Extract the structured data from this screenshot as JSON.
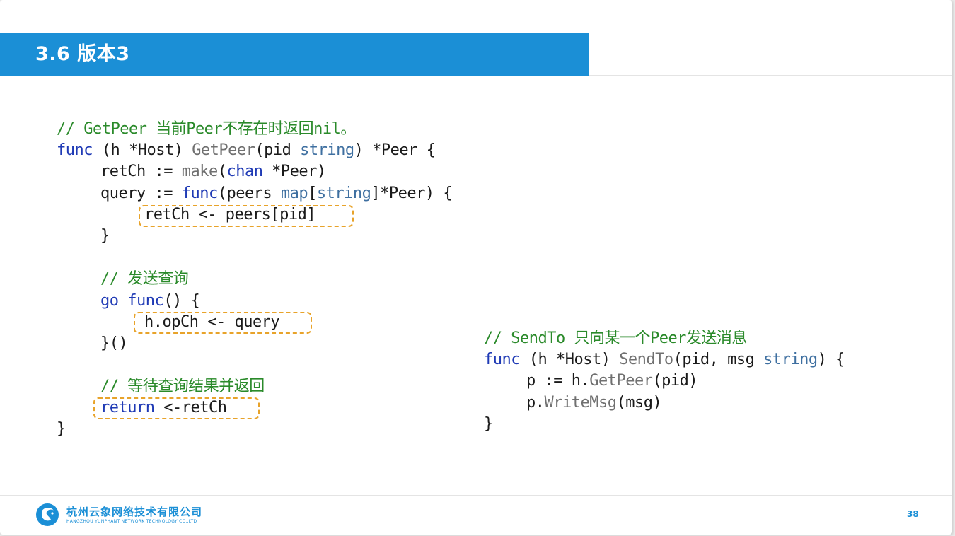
{
  "title": "3.6 版本3",
  "page_number": "38",
  "company": {
    "name_cn": "杭州云象网络技术有限公司",
    "name_en": "HANGZHOU YUNPHANT NETWORK TECHNOLOGY CO.,LTD"
  },
  "code_left": {
    "line1": "// GetPeer 当前Peer不存在时返回nil。",
    "line2": {
      "kw": "func",
      "a": " (h *Host) ",
      "fn": "GetPeer",
      "b": "(pid ",
      "ty": "string",
      "c": ") *Peer {"
    },
    "line3": {
      "a": "retCh := ",
      "fn": "make",
      "b": "(",
      "kw": "chan",
      "c": " *Peer)"
    },
    "line4": {
      "a": "query := ",
      "kw": "func",
      "b": "(peers ",
      "ty": "map",
      "c": "[",
      "ty2": "string",
      "d": "]*Peer) {"
    },
    "line5": "retCh <- peers[pid]",
    "line6": "}",
    "line7": "// 发送查询",
    "line8": {
      "kw": "go",
      "a": " ",
      "kw2": "func",
      "b": "() {"
    },
    "line9": "h.opCh <- query",
    "line10": "}()",
    "line11": "// 等待查询结果并返回",
    "line12": {
      "kw": "return",
      "a": " <-retCh"
    },
    "line13": "}"
  },
  "code_right": {
    "line1": "// SendTo 只向某一个Peer发送消息",
    "line2": {
      "kw": "func",
      "a": " (h *Host) ",
      "fn": "SendTo",
      "b": "(pid, msg ",
      "ty": "string",
      "c": ") {"
    },
    "line3": {
      "a": "p := h.",
      "fn": "GetPeer",
      "b": "(pid)"
    },
    "line4": {
      "a": "p.",
      "fn": "WriteMsg",
      "b": "(msg)"
    },
    "line5": "}"
  }
}
